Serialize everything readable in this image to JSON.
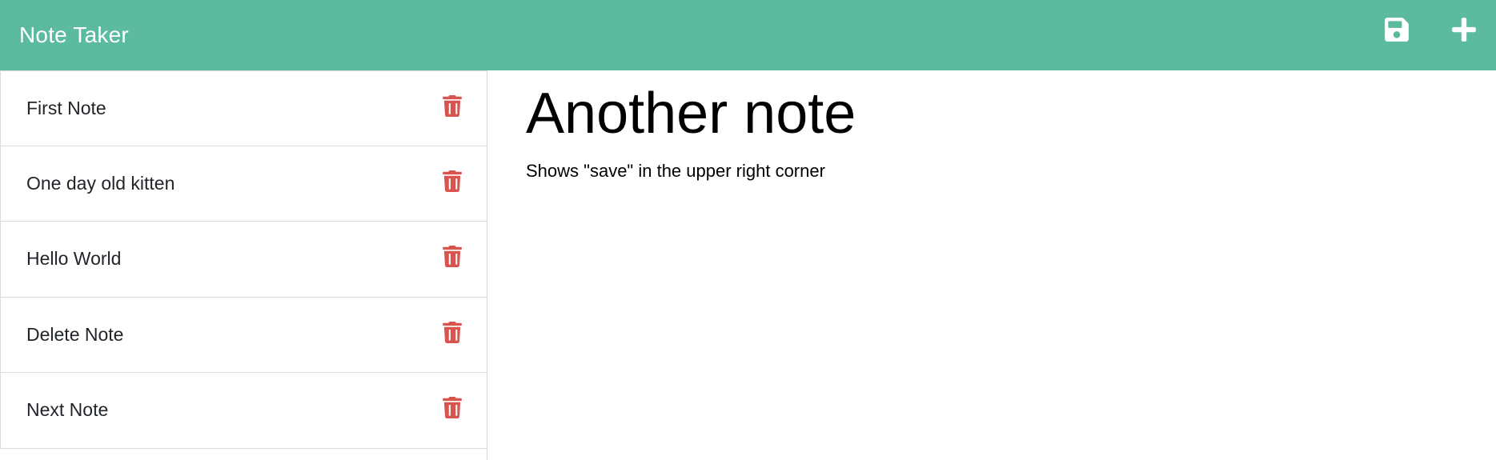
{
  "app": {
    "title": "Note Taker"
  },
  "toolbar": {
    "save_icon": "save-icon",
    "new_icon": "plus-icon"
  },
  "sidebar": {
    "items": [
      {
        "label": "First Note"
      },
      {
        "label": "One day old kitten"
      },
      {
        "label": "Hello World"
      },
      {
        "label": "Delete Note"
      },
      {
        "label": "Next Note"
      }
    ]
  },
  "active_note": {
    "title": "Another note",
    "text": "Shows \"save\" in the upper right corner"
  },
  "colors": {
    "navbar": "#5cbb9e",
    "delete_icon": "#d9534f",
    "nav_icons": "#ffffff"
  }
}
